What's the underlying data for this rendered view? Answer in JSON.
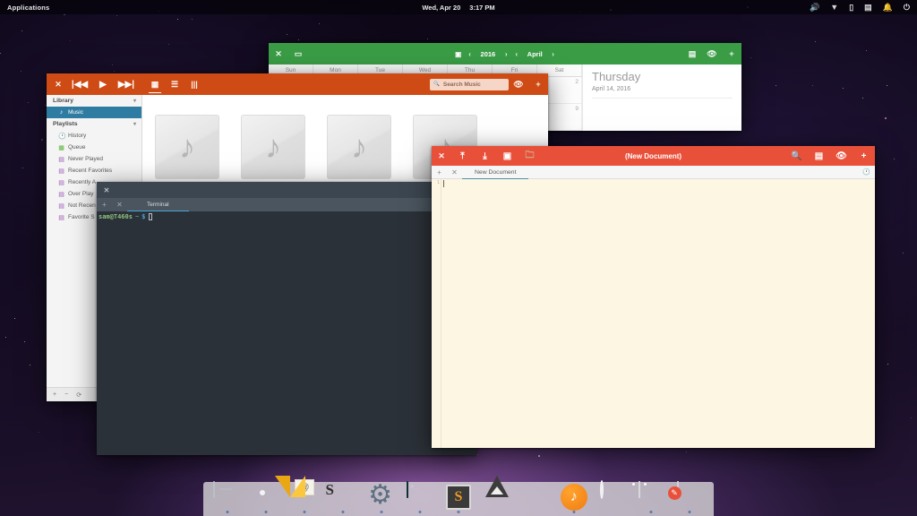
{
  "topbar": {
    "applications_label": "Applications",
    "date": "Wed, Apr 20",
    "time": "3:17 PM",
    "tray": [
      {
        "name": "volume-icon",
        "glyph": "🔊"
      },
      {
        "name": "network-icon",
        "glyph": "▼"
      },
      {
        "name": "battery-icon",
        "glyph": "▯"
      },
      {
        "name": "printer-icon",
        "glyph": "▤"
      },
      {
        "name": "notifications-icon",
        "glyph": "🔔"
      },
      {
        "name": "power-icon",
        "glyph": "⏻"
      }
    ]
  },
  "calendar": {
    "accent": "#3a9d46",
    "title": "",
    "close_glyph": "✕",
    "window_glyph": "▭",
    "today_glyph": "▣",
    "prev_glyph": "‹",
    "next_glyph": "›",
    "year": "2016",
    "month": "April",
    "menu_glyph": "▤",
    "eye_glyph": "👁",
    "plus_glyph": "+",
    "weekdays": [
      "Sun",
      "Mon",
      "Tue",
      "Wed",
      "Thu",
      "Fri",
      "Sat"
    ],
    "rows": [
      [
        "",
        "",
        "",
        "",
        "",
        "",
        "2"
      ],
      [
        "",
        "",
        "",
        "",
        "",
        "",
        "9"
      ]
    ],
    "sidebar": {
      "day_name": "Thursday",
      "date_text": "April 14, 2016"
    }
  },
  "music": {
    "accent": "#cf4b15",
    "close_glyph": "✕",
    "prev_glyph": "|◀◀",
    "play_glyph": "▶",
    "next_glyph": "▶▶|",
    "view_grid_glyph": "▦",
    "view_list_glyph": "☰",
    "view_columns_glyph": "|||",
    "search_placeholder": "Search Music",
    "search_icon_glyph": "🔍",
    "eye_glyph": "👁",
    "plus_glyph": "+",
    "sidebar": {
      "library_header": "Library",
      "library_items": [
        {
          "label": "Music",
          "icon": "note-icon",
          "glyph": "♪",
          "selected": true
        }
      ],
      "playlists_header": "Playlists",
      "playlist_items": [
        {
          "label": "History",
          "icon": "clock-icon",
          "glyph": "🕐"
        },
        {
          "label": "Queue",
          "icon": "queue-icon",
          "glyph": "▦"
        },
        {
          "label": "Never Played",
          "icon": "playlist-icon",
          "glyph": "▤"
        },
        {
          "label": "Recent Favorites",
          "icon": "playlist-icon",
          "glyph": "▤"
        },
        {
          "label": "Recently A",
          "icon": "playlist-icon",
          "glyph": "▤"
        },
        {
          "label": "Over Play",
          "icon": "playlist-icon",
          "glyph": "▤"
        },
        {
          "label": "Not Recen",
          "icon": "playlist-icon",
          "glyph": "▤"
        },
        {
          "label": "Favorite S",
          "icon": "playlist-icon",
          "glyph": "▤"
        }
      ],
      "chevron_glyph": "▾",
      "bottom": {
        "add_glyph": "+",
        "remove_glyph": "−",
        "repeat_glyph": "⟳"
      }
    },
    "albums": [
      {
        "art_glyph": "♪"
      },
      {
        "art_glyph": "♪"
      },
      {
        "art_glyph": "♪"
      },
      {
        "art_glyph": "♪"
      }
    ]
  },
  "terminal": {
    "accent": "#3c4650",
    "close_glyph": "✕",
    "tab_plus_glyph": "+",
    "tab_close_glyph": "✕",
    "tab_label": "Terminal",
    "prompt_user": "sam@T460s",
    "prompt_path": "~",
    "prompt_symbol": "$"
  },
  "editor": {
    "accent": "#e8503a",
    "title": "(New Document)",
    "close_glyph": "✕",
    "save_glyph": "⤒",
    "open_glyph": "⤓",
    "revert_glyph": "▣",
    "folder_glyph": "🗀",
    "search_glyph": "🔍",
    "menu_glyph": "▤",
    "eye_glyph": "👁",
    "plus_glyph": "+",
    "tab_plus_glyph": "+",
    "tab_close_glyph": "✕",
    "tab_label": "New Document",
    "clock_glyph": "🕐",
    "line_numbers": [
      "1"
    ],
    "content": ""
  },
  "dock": {
    "items": [
      {
        "name": "dock-item-files",
        "label": "Files",
        "icon": "files-icon",
        "running": true
      },
      {
        "name": "dock-item-chrome",
        "label": "Google Chrome",
        "icon": "chrome-icon",
        "running": true
      },
      {
        "name": "dock-item-mail",
        "label": "Mail",
        "icon": "mail-icon",
        "running": true
      },
      {
        "name": "dock-item-slack",
        "label": "Slack",
        "icon": "slack-icon",
        "running": true
      },
      {
        "name": "dock-item-settings",
        "label": "Settings",
        "icon": "gear-icon",
        "running": true
      },
      {
        "name": "dock-item-terminal",
        "label": "Terminal",
        "icon": "terminal-icon",
        "running": true
      },
      {
        "name": "dock-item-sublime",
        "label": "Sublime Text",
        "icon": "sublime-icon",
        "running": true
      },
      {
        "name": "dock-item-inkscape",
        "label": "Inkscape",
        "icon": "inkscape-icon",
        "running": false
      },
      {
        "name": "dock-item-photos",
        "label": "Photos",
        "icon": "photos-icon",
        "running": false
      },
      {
        "name": "dock-item-music",
        "label": "Music",
        "icon": "music-icon",
        "running": true
      },
      {
        "name": "dock-item-browser",
        "label": "Browser",
        "icon": "orb-icon",
        "running": false
      },
      {
        "name": "dock-item-calendar",
        "label": "Calendar",
        "icon": "calendar-icon",
        "running": true
      },
      {
        "name": "dock-item-editor",
        "label": "Text Editor",
        "icon": "editor-icon",
        "running": true
      }
    ]
  }
}
